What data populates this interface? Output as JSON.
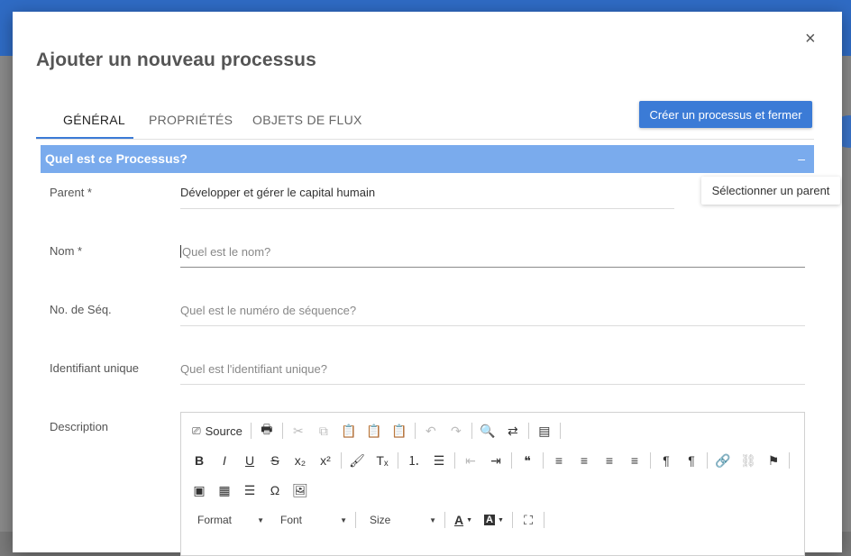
{
  "dialog": {
    "title": "Ajouter un nouveau processus",
    "close_label": "×"
  },
  "tabs": [
    {
      "label": "GÉNÉRAL",
      "active": true
    },
    {
      "label": "PROPRIÉTÉS",
      "active": false
    },
    {
      "label": "OBJETS DE FLUX",
      "active": false
    }
  ],
  "primary_button": "Créer un processus et fermer",
  "section": {
    "title": "Quel est ce Processus?",
    "collapse_label": "–"
  },
  "fields": {
    "parent": {
      "label": "Parent  *",
      "value": "Développer et gérer le capital humain",
      "action": "Sélectionner un parent"
    },
    "name": {
      "label": "Nom *",
      "placeholder": "Quel est le nom?"
    },
    "seq": {
      "label": "No. de Séq.",
      "placeholder": "Quel est le numéro de séquence?"
    },
    "uid": {
      "label": "Identifiant unique",
      "placeholder": "Quel est l'identifiant unique?"
    },
    "description": {
      "label": "Description"
    }
  },
  "editor": {
    "source_label": "Source",
    "format_label": "Format",
    "font_label": "Font",
    "size_label": "Size",
    "toolbar_row1": [
      {
        "name": "print-icon",
        "glyph": "🖶"
      },
      {
        "sep": true
      },
      {
        "name": "cut-icon",
        "glyph": "✂",
        "disabled": true
      },
      {
        "name": "copy-icon",
        "glyph": "⧉",
        "disabled": true
      },
      {
        "name": "paste-icon",
        "glyph": "📋"
      },
      {
        "name": "paste-text-icon",
        "glyph": "📋"
      },
      {
        "name": "paste-word-icon",
        "glyph": "📋"
      },
      {
        "sep": true
      },
      {
        "name": "undo-icon",
        "glyph": "↶",
        "disabled": true
      },
      {
        "name": "redo-icon",
        "glyph": "↷",
        "disabled": true
      },
      {
        "sep": true
      },
      {
        "name": "find-icon",
        "glyph": "🔍"
      },
      {
        "name": "replace-icon",
        "glyph": "⇄"
      },
      {
        "sep": true
      },
      {
        "name": "select-all-icon",
        "glyph": "▤"
      },
      {
        "sep": true
      }
    ],
    "toolbar_row2": [
      {
        "name": "bold-icon",
        "glyph": "B"
      },
      {
        "name": "italic-icon",
        "glyph": "I"
      },
      {
        "name": "underline-icon",
        "glyph": "U"
      },
      {
        "name": "strikethrough-icon",
        "glyph": "S"
      },
      {
        "name": "subscript-icon",
        "glyph": "x₂"
      },
      {
        "name": "superscript-icon",
        "glyph": "x²"
      },
      {
        "sep": true
      },
      {
        "name": "copy-format-icon",
        "glyph": "🖌"
      },
      {
        "name": "remove-format-icon",
        "glyph": "Tₓ"
      },
      {
        "sep": true
      },
      {
        "name": "numbered-list-icon",
        "glyph": "⒈"
      },
      {
        "name": "bulleted-list-icon",
        "glyph": "☰"
      },
      {
        "sep": true
      },
      {
        "name": "outdent-icon",
        "glyph": "⇤",
        "disabled": true
      },
      {
        "name": "indent-icon",
        "glyph": "⇥"
      },
      {
        "sep": true
      },
      {
        "name": "blockquote-icon",
        "glyph": "❝"
      },
      {
        "sep": true
      },
      {
        "name": "align-left-icon",
        "glyph": "≡"
      },
      {
        "name": "align-center-icon",
        "glyph": "≡"
      },
      {
        "name": "align-right-icon",
        "glyph": "≡"
      },
      {
        "name": "align-justify-icon",
        "glyph": "≡"
      },
      {
        "sep": true
      },
      {
        "name": "text-ltr-icon",
        "glyph": "¶"
      },
      {
        "name": "text-rtl-icon",
        "glyph": "¶"
      },
      {
        "sep": true
      },
      {
        "name": "link-icon",
        "glyph": "🔗"
      },
      {
        "name": "unlink-icon",
        "glyph": "⛓",
        "disabled": true
      },
      {
        "name": "anchor-icon",
        "glyph": "⚑"
      },
      {
        "sep": true
      }
    ],
    "toolbar_row3": [
      {
        "name": "flash-icon",
        "glyph": "▣"
      },
      {
        "name": "table-icon",
        "glyph": "▦"
      },
      {
        "name": "horizontal-line-icon",
        "glyph": "☰"
      },
      {
        "name": "special-char-icon",
        "glyph": "Ω"
      },
      {
        "name": "image-icon",
        "glyph": "🖼"
      }
    ]
  }
}
